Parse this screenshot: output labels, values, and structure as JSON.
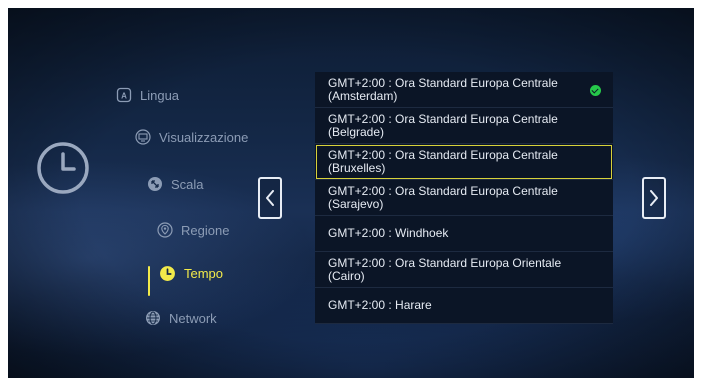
{
  "menu": {
    "items": [
      {
        "label": "Lingua",
        "icon": "language-icon"
      },
      {
        "label": "Visualizzazione",
        "icon": "display-icon"
      },
      {
        "label": "Scala",
        "icon": "scale-icon"
      },
      {
        "label": "Regione",
        "icon": "location-pin-icon"
      },
      {
        "label": "Tempo",
        "icon": "clock-icon",
        "active": true
      },
      {
        "label": "Network",
        "icon": "globe-icon"
      }
    ]
  },
  "timezones": [
    {
      "label": "GMT+2:00 : Ora Standard Europa Centrale (Amsterdam)",
      "checked": true
    },
    {
      "label": "GMT+2:00 : Ora Standard Europa Centrale (Belgrade)"
    },
    {
      "label": "GMT+2:00 : Ora Standard Europa Centrale (Bruxelles)",
      "selected": true
    },
    {
      "label": "GMT+2:00 : Ora Standard Europa Centrale (Sarajevo)"
    },
    {
      "label": "GMT+2:00 : Windhoek"
    },
    {
      "label": "GMT+2:00 : Ora Standard Europa Orientale (Cairo)"
    },
    {
      "label": "GMT+2:00 : Harare"
    }
  ],
  "colors": {
    "accent": "#f2ea4a",
    "check": "#26c94a",
    "highlight_border": "#d7d13a"
  }
}
